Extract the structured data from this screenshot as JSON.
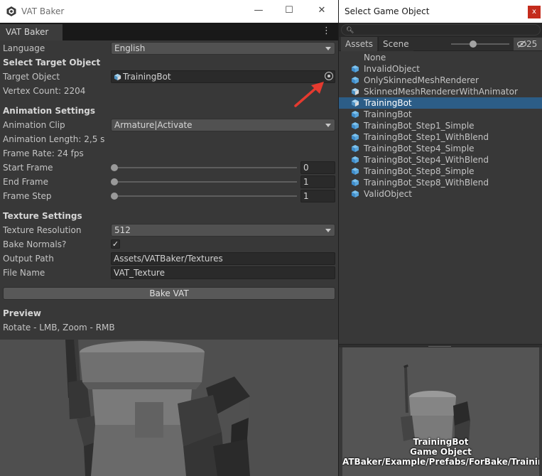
{
  "left_window": {
    "title": "VAT Baker",
    "controls": {
      "minimize": "—",
      "maximize": "☐",
      "close": "✕"
    },
    "tab": "VAT Baker",
    "language": {
      "label": "Language",
      "value": "English"
    },
    "select_target": {
      "header": "Select Target Object",
      "target_label": "Target Object",
      "target_value": "TrainingBot",
      "vertex_count": "Vertex Count: 2204"
    },
    "animation": {
      "header": "Animation Settings",
      "clip_label": "Animation Clip",
      "clip_value": "Armature|Activate",
      "length": "Animation Length: 2,5 s",
      "frame_rate": "Frame Rate: 24 fps",
      "start_label": "Start Frame",
      "start_value": "0",
      "end_label": "End Frame",
      "end_value": "1",
      "step_label": "Frame Step",
      "step_value": "1"
    },
    "texture": {
      "header": "Texture Settings",
      "resolution_label": "Texture Resolution",
      "resolution_value": "512",
      "normals_label": "Bake Normals?",
      "normals_checked": true,
      "output_label": "Output Path",
      "output_value": "Assets/VATBaker/Textures",
      "file_label": "File Name",
      "file_value": "VAT_Texture"
    },
    "bake_button": "Bake VAT",
    "preview": {
      "header": "Preview",
      "hint": "Rotate - LMB, Zoom - RMB"
    }
  },
  "right_window": {
    "title": "Select Game Object",
    "close": "x",
    "tabs": [
      "Assets",
      "Scene"
    ],
    "hidden_count": "25",
    "items": [
      {
        "label": "None",
        "icon": "none",
        "selected": false
      },
      {
        "label": "InvalidObject",
        "icon": "prefab-cube-icon",
        "selected": false
      },
      {
        "label": "OnlySkinnedMeshRenderer",
        "icon": "prefab-cube-icon",
        "selected": false
      },
      {
        "label": "SkinnedMeshRendererWithAnimator",
        "icon": "model-cube-icon",
        "selected": false
      },
      {
        "label": "TrainingBot",
        "icon": "model-cube-icon",
        "selected": true
      },
      {
        "label": "TrainingBot",
        "icon": "prefab-cube-icon",
        "selected": false
      },
      {
        "label": "TrainingBot_Step1_Simple",
        "icon": "prefab-cube-icon",
        "selected": false
      },
      {
        "label": "TrainingBot_Step1_WithBlend",
        "icon": "prefab-cube-icon",
        "selected": false
      },
      {
        "label": "TrainingBot_Step4_Simple",
        "icon": "prefab-cube-icon",
        "selected": false
      },
      {
        "label": "TrainingBot_Step4_WithBlend",
        "icon": "prefab-cube-icon",
        "selected": false
      },
      {
        "label": "TrainingBot_Step8_Simple",
        "icon": "prefab-cube-icon",
        "selected": false
      },
      {
        "label": "TrainingBot_Step8_WithBlend",
        "icon": "prefab-cube-icon",
        "selected": false
      },
      {
        "label": "ValidObject",
        "icon": "prefab-cube-icon",
        "selected": false
      }
    ],
    "preview": {
      "name": "TrainingBot",
      "type": "Game Object",
      "path": "ATBaker/Example/Prefabs/ForBake/TrainingB"
    }
  }
}
